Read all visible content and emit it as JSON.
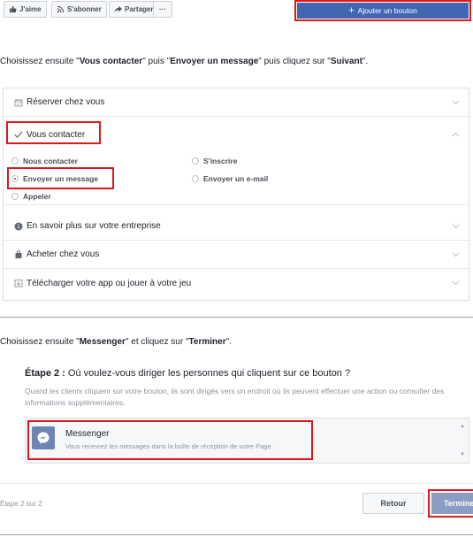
{
  "toolbar": {
    "like_label": "J'aime",
    "subscribe_label": "S'abonner",
    "share_label": "Partager",
    "more_label": "···",
    "add_button_label": "Ajouter un bouton"
  },
  "instruction1": {
    "prefix": "Choisissez ensuite \"",
    "b1": "Vous contacter",
    "mid1": "\" puis \"",
    "b2": "Envoyer un message",
    "mid2": "\" puis cliquez sur \"",
    "b3": "Suivant",
    "suffix": "\"."
  },
  "accordion": {
    "rows": [
      {
        "label": "Réserver chez vous",
        "icon": "calendar-icon"
      },
      {
        "label": "Vous contacter",
        "icon": "check-icon"
      },
      {
        "label": "En savoir plus sur votre entreprise",
        "icon": "info-icon"
      },
      {
        "label": "Acheter chez vous",
        "icon": "bag-icon"
      },
      {
        "label": "Télécharger votre app ou jouer à votre jeu",
        "icon": "download-icon"
      }
    ],
    "options": [
      {
        "label": "Nous contacter",
        "selected": false
      },
      {
        "label": "S'inscrire",
        "selected": false
      },
      {
        "label": "Envoyer un message",
        "selected": true
      },
      {
        "label": "Envoyer un e-mail",
        "selected": false
      },
      {
        "label": "Appeler",
        "selected": false
      }
    ]
  },
  "instruction2": {
    "prefix": "Choisissez ensuite \"",
    "b1": "Messenger",
    "mid1": "\" et cliquez sur \"",
    "b2": "Terminer",
    "suffix": "\"."
  },
  "step2": {
    "title_bold": "Étape 2 :",
    "title_rest": " Où voulez-vous diriger les personnes qui cliquent sur ce bouton ?",
    "description": "Quand les clients cliquent sur votre bouton, ils sont dirigés vers un endroit où ils peuvent effectuer une action ou consulter des informations supplémentaires.",
    "option_name": "Messenger",
    "option_desc": "Vous recevrez les messages dans la boîte de réception de votre Page."
  },
  "footer": {
    "step_count": "Étape 2 sur 2",
    "back_label": "Retour",
    "finish_label": "Terminer"
  },
  "colors": {
    "primary": "#4267b2",
    "highlight": "#e0181b",
    "disabled_primary": "#8b9dc3"
  }
}
